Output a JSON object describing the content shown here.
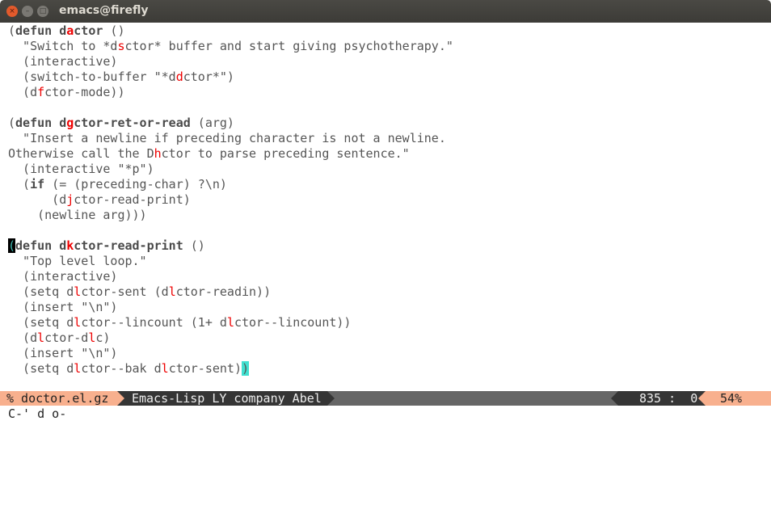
{
  "window": {
    "title": "emacs@firefly",
    "close_icon": "×",
    "min_icon": "–",
    "max_icon": "□"
  },
  "buffer": {
    "lines": [
      [
        {
          "t": "(",
          "s": ""
        },
        {
          "t": "defun",
          "s": "kw"
        },
        {
          "t": " ",
          "s": ""
        },
        {
          "t": "d",
          "s": "kw"
        },
        {
          "t": "a",
          "s": "kw red"
        },
        {
          "t": "ctor",
          "s": "kw"
        },
        {
          "t": " ()",
          "s": ""
        }
      ],
      [
        {
          "t": "  \"Switch to *d",
          "s": ""
        },
        {
          "t": "s",
          "s": "red"
        },
        {
          "t": "ctor* buffer and start giving psychotherapy.\"",
          "s": ""
        }
      ],
      [
        {
          "t": "  (interactive)",
          "s": ""
        }
      ],
      [
        {
          "t": "  (switch-to-buffer \"*d",
          "s": ""
        },
        {
          "t": "d",
          "s": "red"
        },
        {
          "t": "ctor*\")",
          "s": ""
        }
      ],
      [
        {
          "t": "  (d",
          "s": ""
        },
        {
          "t": "f",
          "s": "red"
        },
        {
          "t": "ctor-mode))",
          "s": ""
        }
      ],
      [],
      [
        {
          "t": "(",
          "s": ""
        },
        {
          "t": "defun",
          "s": "kw"
        },
        {
          "t": " ",
          "s": ""
        },
        {
          "t": "d",
          "s": "kw"
        },
        {
          "t": "g",
          "s": "kw red"
        },
        {
          "t": "ctor-ret-or-read",
          "s": "kw"
        },
        {
          "t": " (arg)",
          "s": ""
        }
      ],
      [
        {
          "t": "  \"Insert a newline if preceding character is not a newline.",
          "s": ""
        }
      ],
      [
        {
          "t": "Otherwise call the D",
          "s": ""
        },
        {
          "t": "h",
          "s": "red"
        },
        {
          "t": "ctor to parse preceding sentence.\"",
          "s": ""
        }
      ],
      [
        {
          "t": "  (interactive \"*p\")",
          "s": ""
        }
      ],
      [
        {
          "t": "  (",
          "s": ""
        },
        {
          "t": "if",
          "s": "kw"
        },
        {
          "t": " (= (preceding-char) ?\\n)",
          "s": ""
        }
      ],
      [
        {
          "t": "      (d",
          "s": ""
        },
        {
          "t": "j",
          "s": "red"
        },
        {
          "t": "ctor-read-print)",
          "s": ""
        }
      ],
      [
        {
          "t": "    (newline arg)))",
          "s": ""
        }
      ],
      [],
      [
        {
          "t": "(",
          "s": "cursor"
        },
        {
          "t": "defun",
          "s": "kw"
        },
        {
          "t": " ",
          "s": ""
        },
        {
          "t": "d",
          "s": "kw"
        },
        {
          "t": "k",
          "s": "kw red"
        },
        {
          "t": "ctor-read-print",
          "s": "kw"
        },
        {
          "t": " ()",
          "s": ""
        }
      ],
      [
        {
          "t": "  \"Top level loop.\"",
          "s": ""
        }
      ],
      [
        {
          "t": "  (interactive)",
          "s": ""
        }
      ],
      [
        {
          "t": "  (setq d",
          "s": ""
        },
        {
          "t": "l",
          "s": "red"
        },
        {
          "t": "ctor-sent (d",
          "s": ""
        },
        {
          "t": "l",
          "s": "red"
        },
        {
          "t": "ctor-readin))",
          "s": ""
        }
      ],
      [
        {
          "t": "  (insert \"\\n\")",
          "s": ""
        }
      ],
      [
        {
          "t": "  (setq d",
          "s": ""
        },
        {
          "t": "l",
          "s": "red"
        },
        {
          "t": "ctor--lincount (1+ d",
          "s": ""
        },
        {
          "t": "l",
          "s": "red"
        },
        {
          "t": "ctor--lincount))",
          "s": ""
        }
      ],
      [
        {
          "t": "  (d",
          "s": ""
        },
        {
          "t": "l",
          "s": "red"
        },
        {
          "t": "ctor-d",
          "s": ""
        },
        {
          "t": "l",
          "s": "red"
        },
        {
          "t": "c)",
          "s": ""
        }
      ],
      [
        {
          "t": "  (insert \"\\n\")",
          "s": ""
        }
      ],
      [
        {
          "t": "  (setq d",
          "s": ""
        },
        {
          "t": "l",
          "s": "red"
        },
        {
          "t": "ctor--bak d",
          "s": ""
        },
        {
          "t": "l",
          "s": "red"
        },
        {
          "t": "ctor-sent)",
          "s": ""
        },
        {
          "t": ")",
          "s": "match"
        }
      ]
    ]
  },
  "modeline": {
    "buffer_name": "% doctor.el.gz",
    "modes": "Emacs-Lisp LY company Abel",
    "position": "835 :  0",
    "percent": "54%"
  },
  "minibuffer": {
    "text": "C-' d o-"
  },
  "colors": {
    "accent": "#f8b08e",
    "dark": "#353535",
    "highlight": "#e00000",
    "paren_match": "#40e0d0"
  }
}
